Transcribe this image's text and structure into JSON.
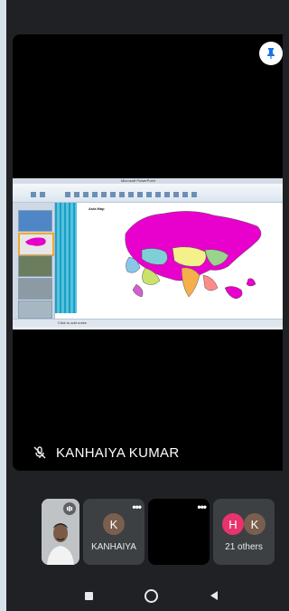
{
  "main": {
    "speaker_name": "KANHAIYA KUMAR",
    "shared_slide": {
      "window_title": "Microsoft PowerPoint",
      "slide_title": "Asia Map",
      "status_text": "Click to add notes"
    }
  },
  "icons": {
    "pin": "pin-icon",
    "mic_off": "mic-off-icon",
    "audio": "audio-level-icon",
    "more": "more-options-icon"
  },
  "participants": [
    {
      "name": "",
      "type": "self-view"
    },
    {
      "name": "KANHAIYA",
      "avatar_letter": "K",
      "avatar_color": "#7a5e4e"
    },
    {
      "name": "",
      "type": "video-off"
    },
    {
      "name": "21 others",
      "avatar_letters": [
        "H",
        "K"
      ],
      "avatar_colors": [
        "#e8336d",
        "#7a5e4e"
      ]
    }
  ],
  "colors": {
    "background": "#202124",
    "tile": "#3c4043",
    "accent": "#1a73e8"
  }
}
